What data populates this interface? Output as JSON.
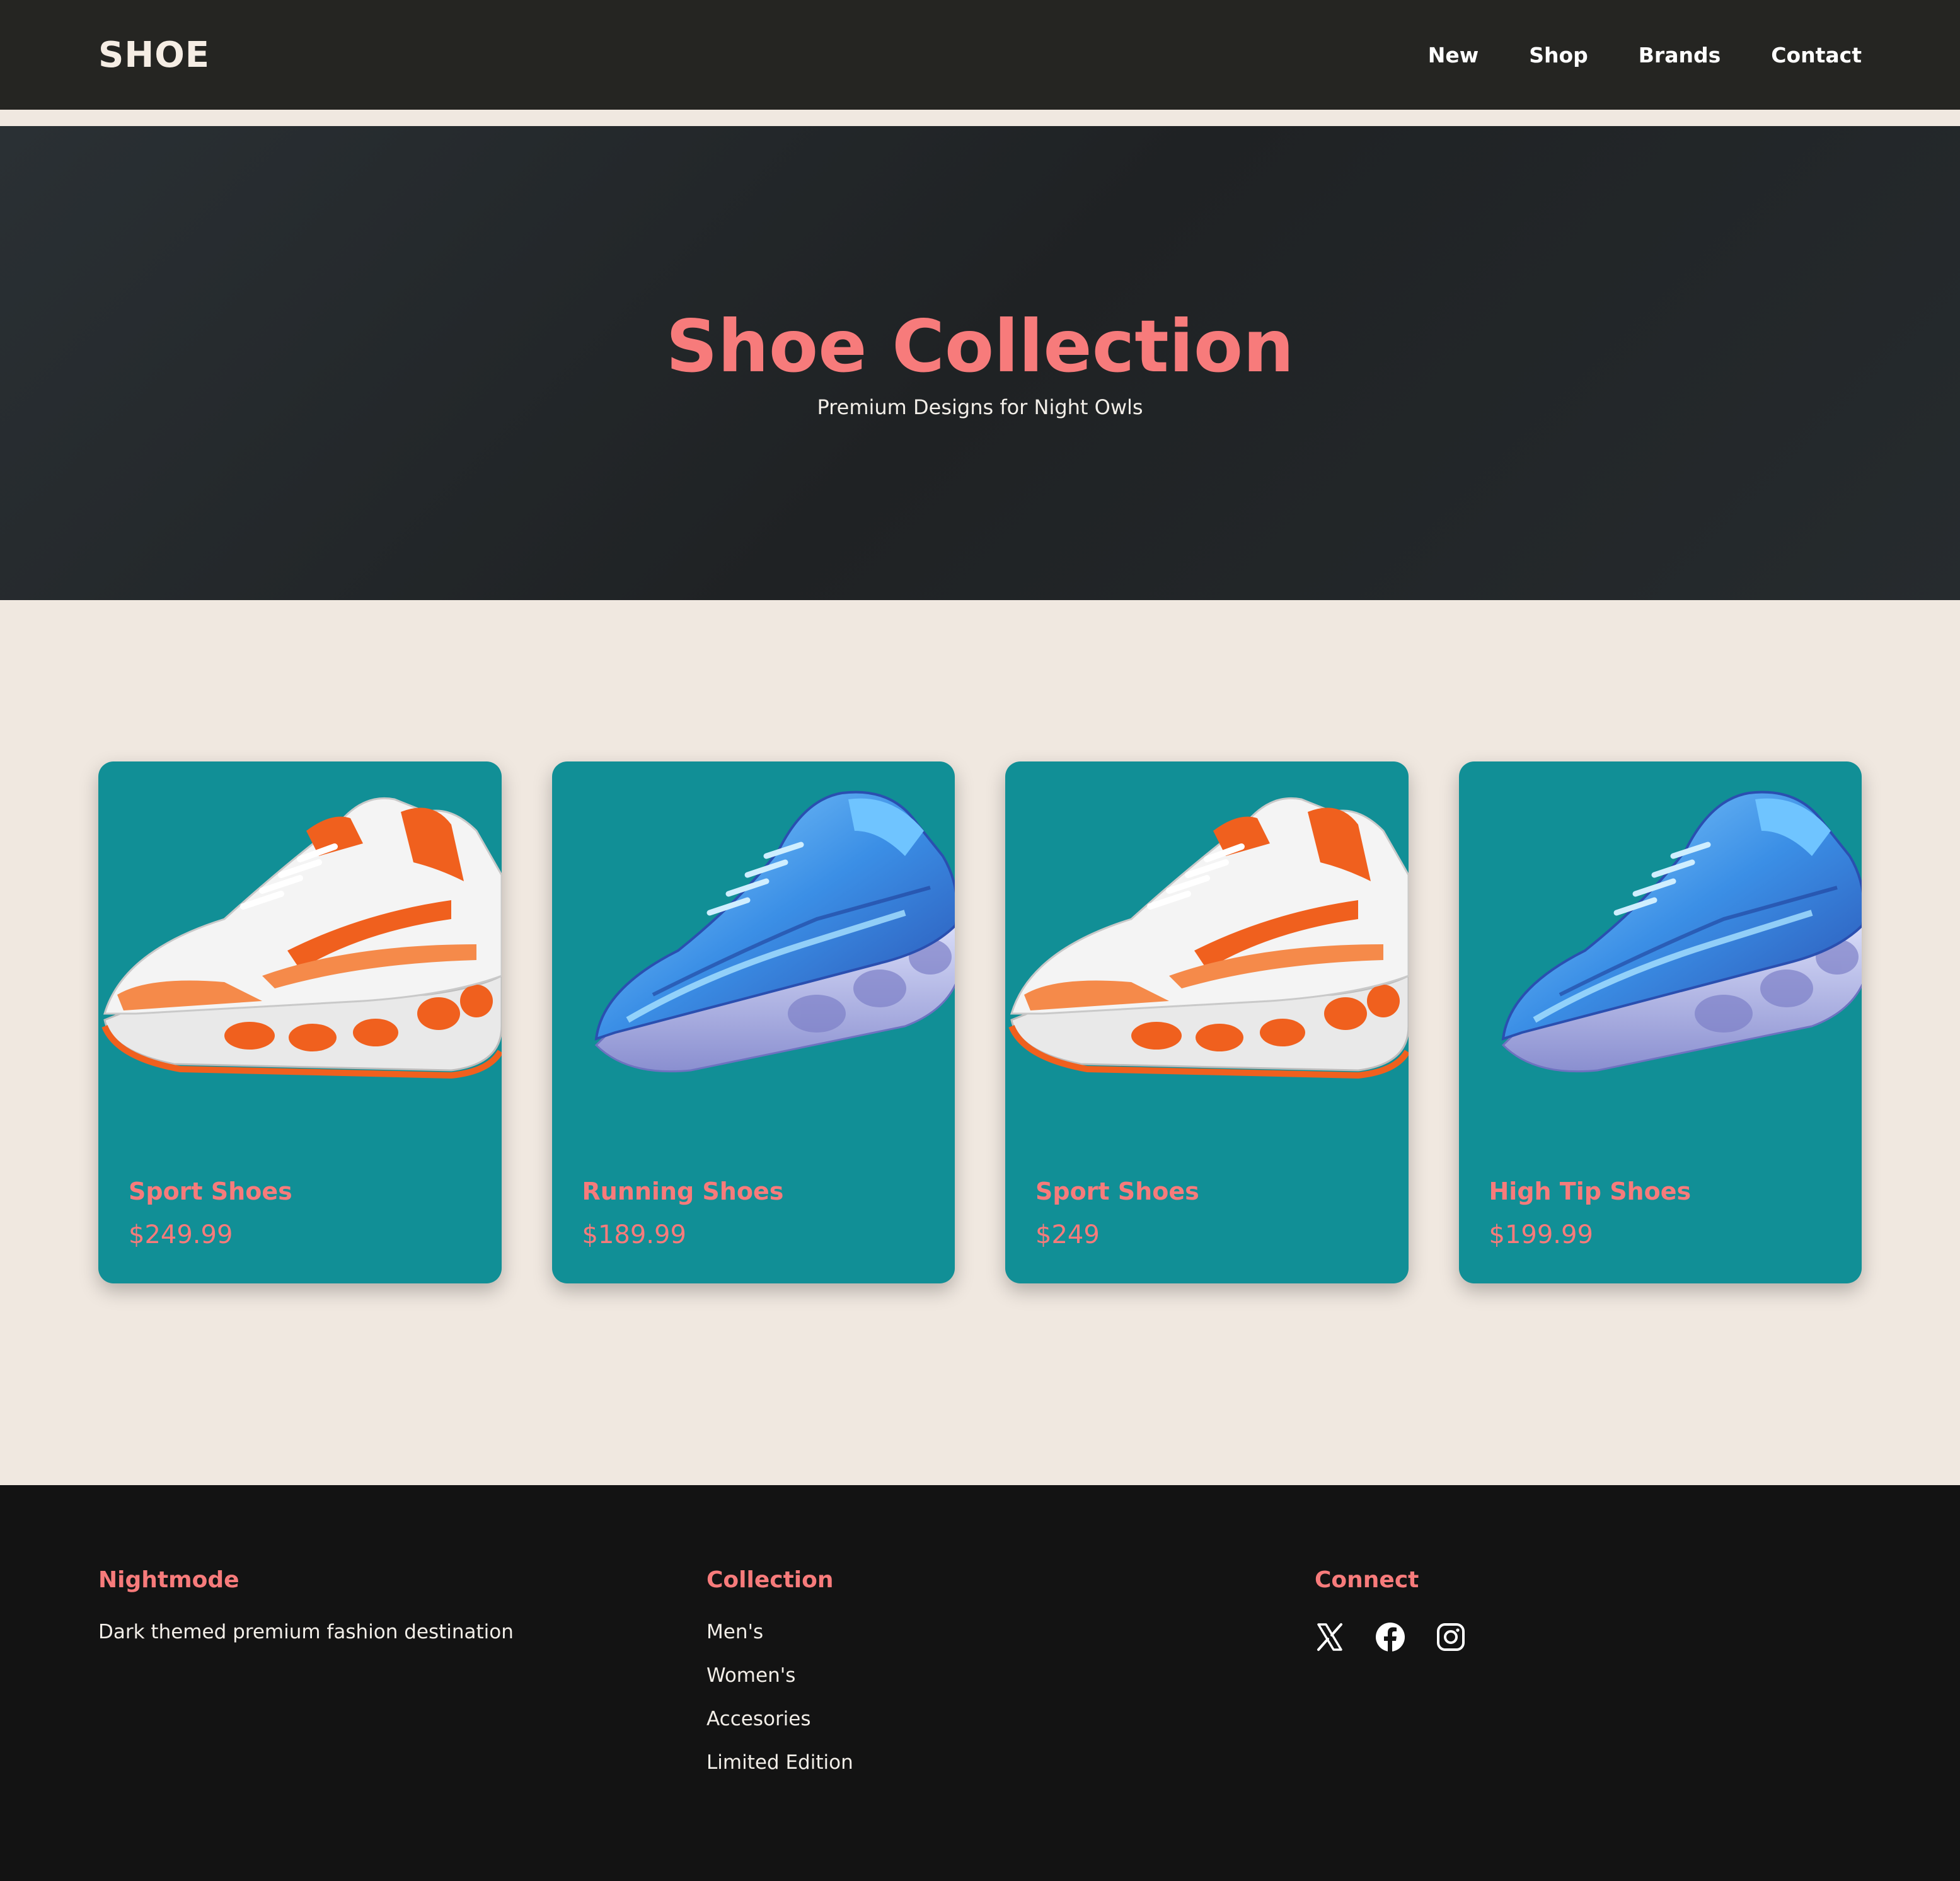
{
  "nav": {
    "logo": "SHOE",
    "links": [
      "New",
      "Shop",
      "Brands",
      "Contact"
    ]
  },
  "hero": {
    "title": "Shoe Collection",
    "subtitle": "Premium Designs for Night Owls"
  },
  "products": [
    {
      "name": "Sport Shoes",
      "price": "$249.99",
      "icon": "white-orange-sneaker-image"
    },
    {
      "name": "Running Shoes",
      "price": "$189.99",
      "icon": "blue-sneaker-image"
    },
    {
      "name": "Sport Shoes",
      "price": "$249",
      "icon": "white-orange-sneaker-image"
    },
    {
      "name": "High Tip Shoes",
      "price": "$199.99",
      "icon": "blue-sneaker-image"
    }
  ],
  "footer": {
    "brand": {
      "title": "Nightmode",
      "text": "Dark themed premium fashion destination"
    },
    "collection": {
      "title": "Collection",
      "items": [
        "Men's",
        "Women's",
        "Accesories",
        "Limited Edition"
      ]
    },
    "connect": {
      "title": "Connect",
      "icons": [
        "x-icon",
        "facebook-icon",
        "instagram-icon"
      ]
    }
  },
  "colors": {
    "accent": "#f77b7b",
    "card": "#118f96",
    "nav_bg": "#252522",
    "footer_bg": "#131313",
    "page_bg": "#f0e8e0"
  }
}
